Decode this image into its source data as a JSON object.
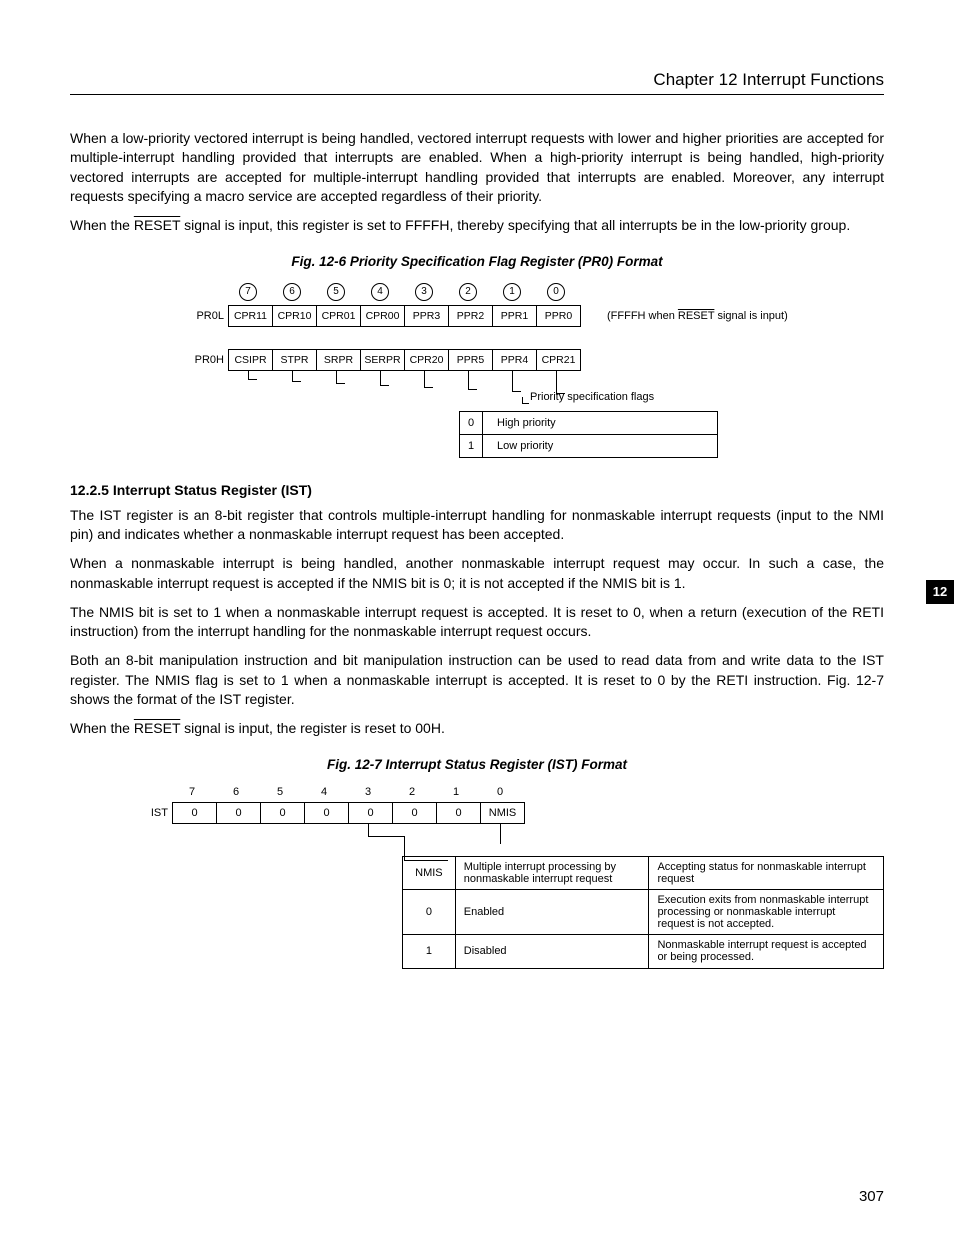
{
  "header": {
    "chapter_title": "Chapter 12   Interrupt Functions"
  },
  "body": {
    "p1": "When a low-priority vectored interrupt is being handled, vectored interrupt requests with lower and higher priorities are accepted for multiple-interrupt handling provided that interrupts are enabled.  When a high-priority interrupt is being handled, high-priority vectored interrupts are accepted for multiple-interrupt handling provided that interrupts are enabled.  Moreover, any interrupt requests specifying a macro service are accepted regardless of their priority.",
    "p2a": "When the ",
    "p2_reset": "RESET",
    "p2b": " signal is input, this register is set to FFFFH, thereby specifying that all interrupts be in the low-priority group."
  },
  "fig126": {
    "caption": "Fig. 12-6  Priority Specification Flag Register (PR0) Format",
    "bits": [
      "7",
      "6",
      "5",
      "4",
      "3",
      "2",
      "1",
      "0"
    ],
    "row_l_label": "PR0L",
    "row_l_cells": [
      "CPR11",
      "CPR10",
      "CPR01",
      "CPR00",
      "PPR3",
      "PPR2",
      "PPR1",
      "PPR0"
    ],
    "row_l_note_a": "(FFFFH when ",
    "row_l_note_reset": "RESET",
    "row_l_note_b": " signal is input)",
    "row_h_label": "PR0H",
    "row_h_cells": [
      "CSIPR",
      "STPR",
      "SRPR",
      "SERPR",
      "CPR20",
      "PPR5",
      "PPR4",
      "CPR21"
    ],
    "flag_label": "Priority specification flags",
    "prio_rows": [
      {
        "v": "0",
        "t": "High priority"
      },
      {
        "v": "1",
        "t": "Low priority"
      }
    ]
  },
  "sec125": {
    "heading": "12.2.5  Interrupt Status Register (IST)",
    "p1": "The IST register is an 8-bit register that controls multiple-interrupt handling for nonmaskable interrupt requests (input to the NMI pin) and indicates whether a nonmaskable interrupt request has been accepted.",
    "p2": "When a nonmaskable interrupt is being handled, another nonmaskable interrupt request may occur.  In such a case, the nonmaskable interrupt request is accepted if the NMIS bit is 0; it is not accepted if the NMIS bit is 1.",
    "p3": "The NMIS bit is set to 1 when a nonmaskable interrupt request is accepted.  It is reset to 0, when a return (execution of the RETI instruction) from the interrupt handling for the nonmaskable interrupt request occurs.",
    "p4": "Both an 8-bit manipulation instruction and bit manipulation instruction can be used to read data from and write data to the IST register.  The NMIS flag is set to 1 when a nonmaskable interrupt is accepted.  It is reset to 0 by the RETI instruction.  Fig. 12-7 shows the format of the IST register.",
    "p5a": "When the ",
    "p5_reset": "RESET",
    "p5b": " signal is input, the register is reset to 00H."
  },
  "fig127": {
    "caption": "Fig. 12-7  Interrupt Status Register (IST) Format",
    "bits": [
      "7",
      "6",
      "5",
      "4",
      "3",
      "2",
      "1",
      "0"
    ],
    "row_label": "IST",
    "row_cells": [
      "0",
      "0",
      "0",
      "0",
      "0",
      "0",
      "0",
      "NMIS"
    ],
    "table": {
      "h1": "NMIS",
      "h2": "Multiple interrupt processing by nonmaskable interrupt request",
      "h3": "Accepting status for nonmaskable interrupt request",
      "r1": {
        "v": "0",
        "a": "Enabled",
        "b": "Execution exits from nonmaskable interrupt processing or nonmaskable interrupt request is not accepted."
      },
      "r2": {
        "v": "1",
        "a": "Disabled",
        "b": "Nonmaskable interrupt request is accepted or being processed."
      }
    }
  },
  "side_tab": "12",
  "page_number": "307"
}
